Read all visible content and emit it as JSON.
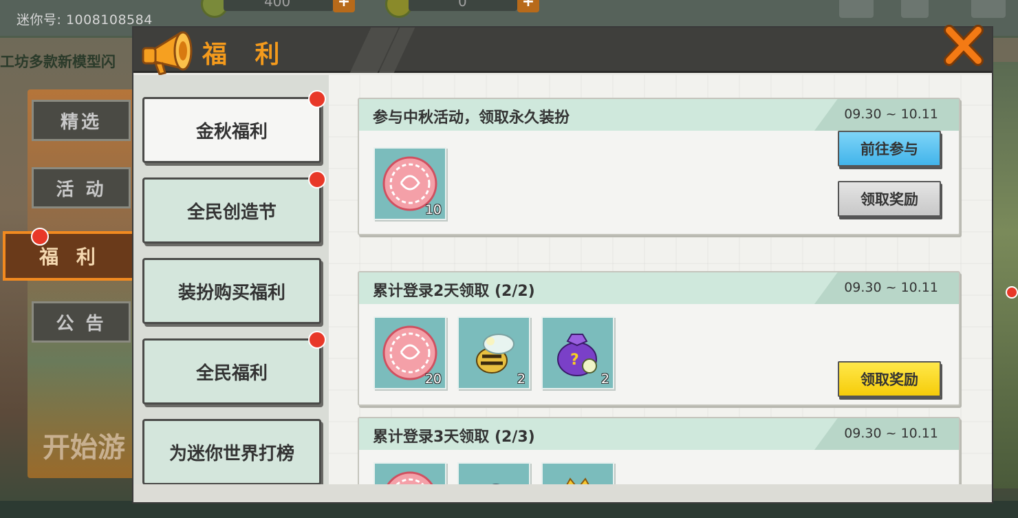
{
  "background": {
    "mini_id": "迷你号: 1008108584",
    "currency_1": "400",
    "currency_2": "0",
    "marquee": "工坊多款新模型闪",
    "start_button": "开始游",
    "side_tabs": [
      "精选",
      "活 动",
      "福 利",
      "公 告"
    ]
  },
  "modal": {
    "title": "福 利",
    "categories": [
      {
        "label": "金秋福利",
        "active": true,
        "badge": true
      },
      {
        "label": "全民创造节",
        "active": false,
        "badge": true
      },
      {
        "label": "装扮购买福利",
        "active": false,
        "badge": false
      },
      {
        "label": "全民福利",
        "active": false,
        "badge": true
      },
      {
        "label": "为迷你世界打榜",
        "active": false,
        "badge": false
      }
    ],
    "cards": [
      {
        "title": "参与中秋活动，领取永久装扮",
        "date": "09.30 ~ 10.11",
        "items": [
          {
            "icon": "mooncake-token-icon",
            "count": "10"
          }
        ],
        "buttons": [
          "前往参与",
          "领取奖励"
        ]
      },
      {
        "title": "累计登录2天领取 (2/2)",
        "date": "09.30 ~ 10.11",
        "items": [
          {
            "icon": "mooncake-token-icon",
            "count": "20"
          },
          {
            "icon": "bee-creature-icon",
            "count": "2"
          },
          {
            "icon": "mystery-bag-icon",
            "count": "2"
          }
        ],
        "buttons": [
          "领取奖励"
        ]
      },
      {
        "title": "累计登录3天领取 (2/3)",
        "date": "09.30 ~ 10.11",
        "items": [
          {
            "icon": "mooncake-token-icon",
            "count": ""
          },
          {
            "icon": "blue-figure-icon",
            "count": ""
          },
          {
            "icon": "gift-box-icon",
            "count": ""
          }
        ],
        "buttons": []
      }
    ]
  },
  "colors": {
    "accent_orange": "#f49a1c",
    "header_dark": "#3f3f3c",
    "card_header_green": "#cfe8dc",
    "btn_blue": "#42b4ea",
    "btn_yellow": "#f6cc0a",
    "badge_red": "#e83828"
  }
}
